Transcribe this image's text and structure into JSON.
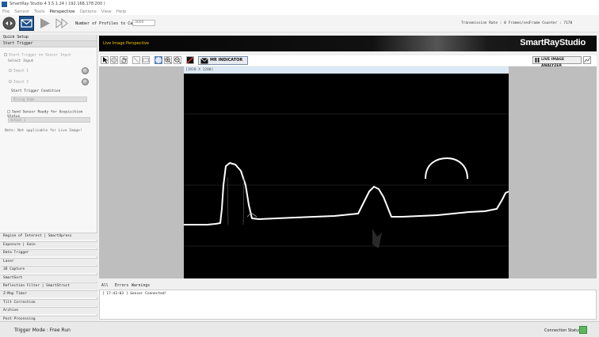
{
  "window": {
    "title": "SmartRay Studio 4 3.5.1.24 ( 192.168.178.200 )"
  },
  "menu": [
    "File",
    "Sensor",
    "Tools",
    "Perspective",
    "Options",
    "View",
    "Help"
  ],
  "toolbar": {
    "profiles_label": "Number of Profiles to Capture",
    "profiles_value": "3000",
    "transmission": "Transmission Rate : 0 Frames/sec",
    "frame_counter": "Frame Counter : 7170"
  },
  "left_panel": {
    "header": "Quick Setup",
    "section": "Start Trigger",
    "start_trigger_sensor_input": "Start Trigger on Sensor Input",
    "select_input": "Select Input",
    "input1": "Input 1",
    "input2": "Input 2",
    "start_trigger_condition": "Start Trigger Condition",
    "rising_edge": "Rising Edge",
    "send_sensor_ready": "Send Sensor Ready for Acquisition Status",
    "output": "Output 1",
    "note": "Note: Not applicable for Live Image!",
    "accordion": [
      "Region of Interest | SmartXpress",
      "Exposure | Gain",
      "Data Trigger",
      "Laser",
      "3D Capture",
      "SmartSort",
      "Reflection Filter | SmartStruct",
      "Z-Map Timer",
      "Tilt Correction",
      "Archive",
      "Post Processing"
    ]
  },
  "banner": {
    "title": "Live Image Perspective",
    "brand": "SmartRayStudio"
  },
  "view": {
    "mr_indicator": "MR INDICATOR",
    "live_image_analyzer": "LIVE IMAGE ANALYZER",
    "resolution": "[1920 X 1280]"
  },
  "log": {
    "tabs": [
      "All",
      "Errors",
      "Warnings"
    ],
    "entries": [
      "[ 17:43:03 ] Sensor Connected!"
    ]
  },
  "status": {
    "trigger_mode": "Trigger Mode : Free Run",
    "connection": "Connection Status",
    "connection_color": "#5cb85c"
  },
  "colors": {
    "accent": "#1e5a9e",
    "banner_title": "#f2c200"
  }
}
